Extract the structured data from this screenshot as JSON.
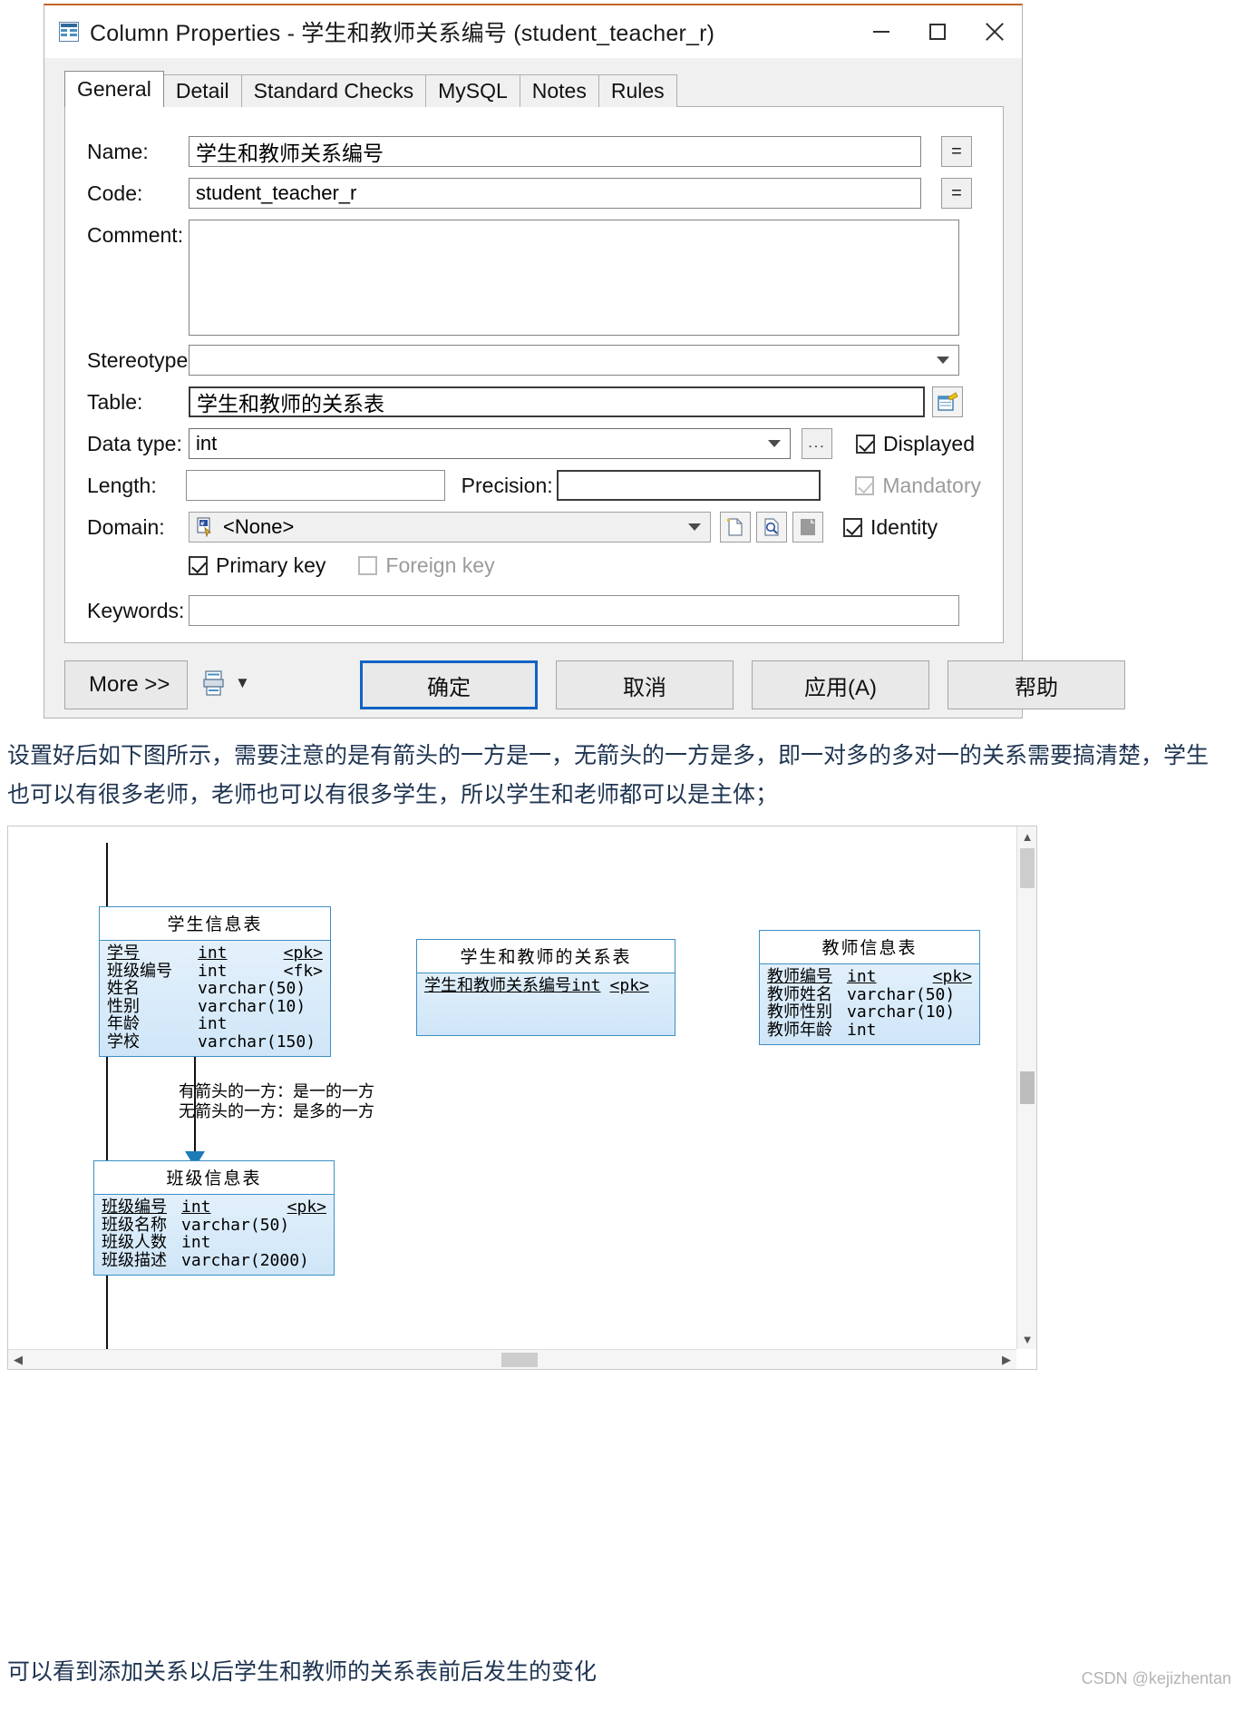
{
  "dialog": {
    "title": "Column Properties - 学生和教师关系编号 (student_teacher_r)",
    "icon": "table-column-icon",
    "window_controls": {
      "minimize": "minimize-icon",
      "maximize": "maximize-icon",
      "close": "close-icon"
    },
    "tabs": [
      {
        "label": "General",
        "active": true
      },
      {
        "label": "Detail",
        "active": false
      },
      {
        "label": "Standard Checks",
        "active": false
      },
      {
        "label": "MySQL",
        "active": false
      },
      {
        "label": "Notes",
        "active": false
      },
      {
        "label": "Rules",
        "active": false
      }
    ],
    "fields": {
      "name_label": "Name:",
      "name_value": "学生和教师关系编号",
      "name_equals_button": "=",
      "code_label": "Code:",
      "code_value": "student_teacher_r",
      "code_equals_button": "=",
      "comment_label": "Comment:",
      "comment_value": "",
      "stereotype_label": "Stereotype:",
      "stereotype_value": "",
      "table_label": "Table:",
      "table_value": "学生和教师的关系表",
      "datatype_label": "Data type:",
      "datatype_value": "int",
      "datatype_more_button": "...",
      "length_label": "Length:",
      "length_value": "",
      "precision_label": "Precision:",
      "precision_value": "",
      "domain_label": "Domain:",
      "domain_value": "<None>",
      "keywords_label": "Keywords:",
      "keywords_value": ""
    },
    "checkboxes": {
      "displayed": {
        "label": "Displayed",
        "checked": true,
        "disabled": false
      },
      "mandatory": {
        "label": "Mandatory",
        "checked": true,
        "disabled": true
      },
      "identity": {
        "label": "Identity",
        "checked": true,
        "disabled": false
      },
      "primary_key": {
        "label": "Primary key",
        "checked": true,
        "disabled": false
      },
      "foreign_key": {
        "label": "Foreign key",
        "checked": false,
        "disabled": true
      }
    },
    "buttons": {
      "more": "More >>",
      "print_dropdown": "▼",
      "ok": "确定",
      "cancel": "取消",
      "apply": "应用(A)",
      "help": "帮助"
    },
    "accent_color": "#1063c4"
  },
  "body": {
    "paragraph1": "设置好后如下图所示，需要注意的是有箭头的一方是一，无箭头的一方是多，即一对多的多对一的关系需要搞清楚，学生也可以有很多老师，老师也可以有很多学生，所以学生和老师都可以是主体；",
    "paragraph2": "可以看到添加关系以后学生和教师的关系表前后发生的变化",
    "watermark": "CSDN @kejizhentan"
  },
  "diagram": {
    "tables": [
      {
        "name": "学生信息表",
        "columns": [
          {
            "col": "学号",
            "type": "int",
            "key": "<pk>",
            "pk": true
          },
          {
            "col": "班级编号",
            "type": "int",
            "key": "<fk>",
            "pk": false
          },
          {
            "col": "姓名",
            "type": "varchar(50)",
            "key": "",
            "pk": false
          },
          {
            "col": "性别",
            "type": "varchar(10)",
            "key": "",
            "pk": false
          },
          {
            "col": "年龄",
            "type": "int",
            "key": "",
            "pk": false
          },
          {
            "col": "学校",
            "type": "varchar(150)",
            "key": "",
            "pk": false
          }
        ]
      },
      {
        "name": "学生和教师的关系表",
        "columns": [
          {
            "col": "学生和教师关系编号",
            "type": "int",
            "key": "<pk>",
            "pk": true
          }
        ]
      },
      {
        "name": "教师信息表",
        "columns": [
          {
            "col": "教师编号",
            "type": "int",
            "key": "<pk>",
            "pk": true
          },
          {
            "col": "教师姓名",
            "type": "varchar(50)",
            "key": "",
            "pk": false
          },
          {
            "col": "教师性别",
            "type": "varchar(10)",
            "key": "",
            "pk": false
          },
          {
            "col": "教师年龄",
            "type": "int",
            "key": "",
            "pk": false
          }
        ]
      },
      {
        "name": "班级信息表",
        "columns": [
          {
            "col": "班级编号",
            "type": "int",
            "key": "<pk>",
            "pk": true
          },
          {
            "col": "班级名称",
            "type": "varchar(50)",
            "key": "",
            "pk": false
          },
          {
            "col": "班级人数",
            "type": "int",
            "key": "",
            "pk": false
          },
          {
            "col": "班级描述",
            "type": "varchar(2000)",
            "key": "",
            "pk": false
          }
        ]
      }
    ],
    "annotation_line1": "有箭头的一方：是一的一方",
    "annotation_line2": "无箭头的一方：是多的一方",
    "border_color": "#3d8fc4"
  }
}
